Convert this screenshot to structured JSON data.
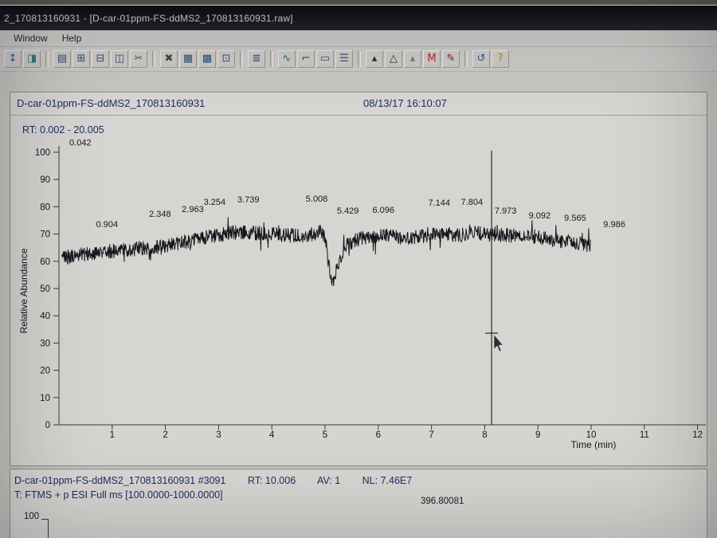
{
  "window": {
    "title": "2_170813160931 - [D-car-01ppm-FS-ddMS2_170813160931.raw]",
    "menu": [
      "Window",
      "Help"
    ]
  },
  "toolbar": {
    "groups": [
      {
        "icons": [
          {
            "name": "toggle-scale-icon",
            "glyph": "↕",
            "color": "#2d50a8"
          },
          {
            "name": "display-options-icon",
            "glyph": "◨",
            "color": "#2d7878"
          }
        ]
      },
      {
        "icons": [
          {
            "name": "layout-grid-icon",
            "glyph": "▤",
            "color": "#2f4f72"
          },
          {
            "name": "add-plot-icon",
            "glyph": "⊞",
            "color": "#2f4f72"
          },
          {
            "name": "remove-plot-icon",
            "glyph": "⊟",
            "color": "#2f4f72"
          },
          {
            "name": "split-view-icon",
            "glyph": "◫",
            "color": "#2f4f72"
          },
          {
            "name": "cut-cell-icon",
            "glyph": "✂",
            "color": "#555555"
          }
        ]
      },
      {
        "icons": [
          {
            "name": "close-view-icon",
            "glyph": "✖",
            "color": "#444444"
          },
          {
            "name": "tile-grid-icon",
            "glyph": "▦",
            "color": "#2f4f72"
          },
          {
            "name": "tile-grid-alt-icon",
            "glyph": "▩",
            "color": "#2f4f72"
          },
          {
            "name": "single-cell-icon",
            "glyph": "⊡",
            "color": "#2f4f72"
          }
        ]
      },
      {
        "icons": [
          {
            "name": "ranges-list-icon",
            "glyph": "≣",
            "color": "#2f4f72"
          }
        ]
      },
      {
        "icons": [
          {
            "name": "chromatogram-view-icon",
            "glyph": "∿",
            "color": "#1f6f6f"
          },
          {
            "name": "axis-setup-icon",
            "glyph": "⌐",
            "color": "#444444"
          },
          {
            "name": "map-view-icon",
            "glyph": "▭",
            "color": "#2f4f72"
          },
          {
            "name": "report-list-icon",
            "glyph": "☰",
            "color": "#2f4f72"
          }
        ]
      },
      {
        "icons": [
          {
            "name": "peak-detect-icon",
            "glyph": "▴",
            "color": "#333333"
          },
          {
            "name": "peak-label-icon",
            "glyph": "△",
            "color": "#333333"
          },
          {
            "name": "peak-area-icon",
            "glyph": "▴",
            "color": "#777777"
          },
          {
            "name": "library-match-icon",
            "glyph": "M",
            "color": "#c22020"
          },
          {
            "name": "annotate-icon",
            "glyph": "✎",
            "color": "#7a2020"
          }
        ]
      },
      {
        "icons": [
          {
            "name": "refresh-icon",
            "glyph": "↺",
            "color": "#2d50a8"
          },
          {
            "name": "help-icon",
            "glyph": "?",
            "color": "#b8860b"
          }
        ]
      }
    ]
  },
  "panel": {
    "title": "D-car-01ppm-FS-ddMS2_170813160931",
    "datetime": "08/13/17 16:10:07"
  },
  "chromatogram": {
    "rt_label": "RT: 0.002 - 20.005",
    "ylabel": "Relative Abundance",
    "xlabel": "Time (min)",
    "x_ticks": [
      1,
      2,
      3,
      4,
      5,
      6,
      7,
      8,
      9,
      10,
      11,
      12
    ],
    "y_ticks": [
      0,
      10,
      20,
      30,
      40,
      50,
      60,
      70,
      80,
      90,
      100
    ],
    "ylim": [
      0,
      100
    ],
    "xlim": [
      0,
      12.3
    ],
    "cursor_time": 8.13,
    "peaks": [
      {
        "label": "0.042",
        "t": 0.042,
        "y": 102.5,
        "dx": 24
      },
      {
        "label": "0.904",
        "t": 0.904,
        "y": 72.5,
        "dx": 0
      },
      {
        "label": "2.348",
        "t": 2.348,
        "y": 76.3,
        "dx": -30
      },
      {
        "label": "2.963",
        "t": 2.963,
        "y": 78.1,
        "dx": -30
      },
      {
        "label": "3.254",
        "t": 3.254,
        "y": 80.7,
        "dx": -22
      },
      {
        "label": "3.739",
        "t": 3.739,
        "y": 81.6,
        "dx": -12
      },
      {
        "label": "5.008",
        "t": 5.008,
        "y": 81.9,
        "dx": -11
      },
      {
        "label": "5.429",
        "t": 5.429,
        "y": 77.5,
        "dx": 0
      },
      {
        "label": "6.096",
        "t": 6.096,
        "y": 77.8,
        "dx": 0
      },
      {
        "label": "7.144",
        "t": 7.144,
        "y": 80.4,
        "dx": 0
      },
      {
        "label": "7.804",
        "t": 7.804,
        "y": 80.7,
        "dx": -3
      },
      {
        "label": "7.973",
        "t": 7.973,
        "y": 77.5,
        "dx": 28
      },
      {
        "label": "9.092",
        "t": 9.092,
        "y": 75.7,
        "dx": -4
      },
      {
        "label": "9.565",
        "t": 9.565,
        "y": 74.9,
        "dx": 9
      },
      {
        "label": "9.986",
        "t": 9.986,
        "y": 72.5,
        "dx": 30
      }
    ],
    "trace": {
      "start": 0.05,
      "end": 9.99,
      "noise": 2.6,
      "spike": 4.5,
      "anchors": [
        [
          0.05,
          61
        ],
        [
          0.4,
          62.5
        ],
        [
          0.9,
          63.5
        ],
        [
          1.4,
          64.5
        ],
        [
          1.9,
          65.5
        ],
        [
          2.35,
          67
        ],
        [
          2.7,
          68.5
        ],
        [
          3.0,
          69.5
        ],
        [
          3.25,
          70.5
        ],
        [
          3.74,
          70.5
        ],
        [
          4.2,
          69.5
        ],
        [
          4.7,
          69.5
        ],
        [
          4.95,
          71
        ],
        [
          5.02,
          67
        ],
        [
          5.08,
          57
        ],
        [
          5.13,
          51.5
        ],
        [
          5.18,
          54
        ],
        [
          5.28,
          61
        ],
        [
          5.43,
          66.5
        ],
        [
          5.7,
          68.5
        ],
        [
          6.1,
          69.5
        ],
        [
          6.6,
          68.5
        ],
        [
          7.14,
          70
        ],
        [
          7.5,
          69.5
        ],
        [
          7.8,
          70.5
        ],
        [
          7.97,
          70
        ],
        [
          8.4,
          69.5
        ],
        [
          8.8,
          69.5
        ],
        [
          9.09,
          68.5
        ],
        [
          9.4,
          67.5
        ],
        [
          9.57,
          67
        ],
        [
          9.8,
          66.5
        ],
        [
          9.99,
          65.5
        ]
      ]
    }
  },
  "spectrum": {
    "file_scan": "D-car-01ppm-FS-ddMS2_170813160931 #3091",
    "rt": "RT: 10.006",
    "av": "AV: 1",
    "nl": "NL: 7.46E7",
    "filter": "T: FTMS + p ESI Full ms [100.0000-1000.0000]",
    "peak_label": "396.80081",
    "ytick_label": "100"
  }
}
